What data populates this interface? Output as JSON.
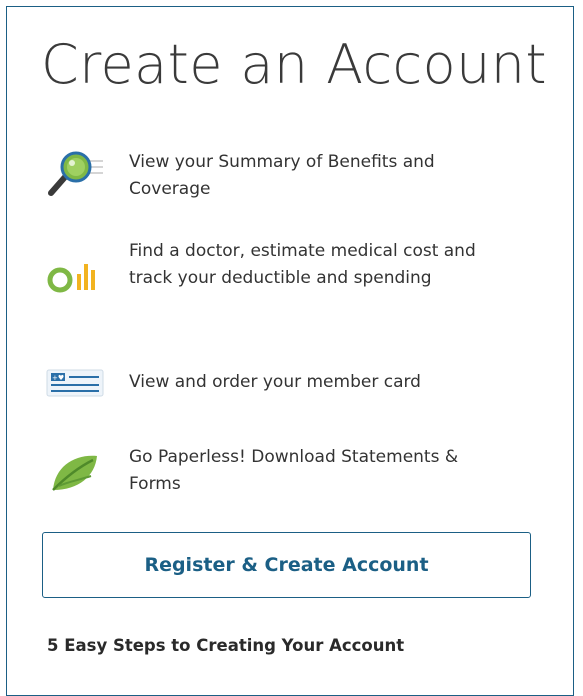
{
  "panel": {
    "title": "Create an Account",
    "features": [
      {
        "icon": "magnifying-glass-icon",
        "text": "View your Summary of Benefits and Coverage"
      },
      {
        "icon": "cost-chart-icon",
        "text": "Find a doctor, estimate medical cost and track your deductible and spending"
      },
      {
        "icon": "member-card-icon",
        "text": "View and order your member card"
      },
      {
        "icon": "leaf-icon",
        "text": "Go Paperless! Download Statements & Forms"
      }
    ],
    "register_label": "Register & Create Account",
    "steps_title": "5 Easy Steps to Creating Your Account"
  },
  "colors": {
    "accent": "#1b5f85",
    "green": "#7fb845",
    "yellow": "#f2b320",
    "card_blue": "#2a6fa8"
  }
}
